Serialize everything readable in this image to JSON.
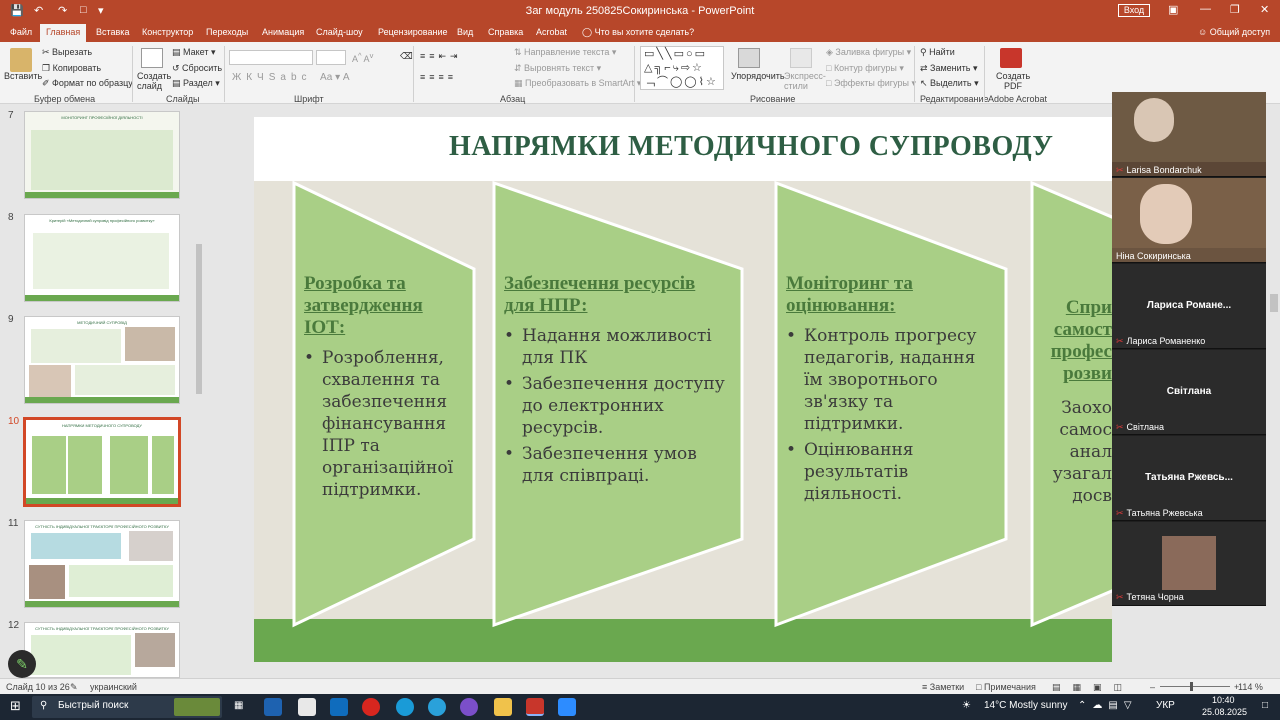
{
  "window": {
    "title": "Заг модуль 250825Сокиринська  -  PowerPoint",
    "signin": "Вход"
  },
  "menu": {
    "tabs": [
      "Файл",
      "Главная",
      "Вставка",
      "Конструктор",
      "Переходы",
      "Анимация",
      "Слайд-шоу",
      "Рецензирование",
      "Вид",
      "Справка",
      "Acrobat"
    ],
    "search": "Что вы хотите сделать?",
    "share": "Общий доступ"
  },
  "ribbon": {
    "paste": "Вставить",
    "cut": "Вырезать",
    "copy": "Копировать",
    "format_painter": "Формат по образцу",
    "clipboard_group": "Буфер обмена",
    "new_slide": "Создать слайд",
    "layout": "Макет",
    "reset": "Сбросить",
    "section": "Раздел",
    "slides_group": "Слайды",
    "font_group": "Шрифт",
    "text_direction": "Направление текста",
    "align_text": "Выровнять текст",
    "convert_smartart": "Преобразовать в SmartArt",
    "paragraph_group": "Абзац",
    "arrange": "Упорядочить",
    "quick_styles": "Экспресс-стили",
    "shape_fill": "Заливка фигуры",
    "shape_outline": "Контур фигуры",
    "shape_effects": "Эффекты фигуры",
    "drawing_group": "Рисование",
    "find": "Найти",
    "replace": "Заменить",
    "select": "Выделить",
    "editing_group": "Редактирование",
    "create_pdf": "Создать PDF",
    "acrobat_group": "Adobe Acrobat"
  },
  "thumbnails": [
    {
      "num": "7",
      "title": "МОНІТОРИНГ ПРОФЕСІЙНОЇ ДІЯЛЬНОСТІ"
    },
    {
      "num": "8",
      "title": "Критерій «Методичний супровід професійного розвитку»"
    },
    {
      "num": "9",
      "title": "МЕТОДИЧНИЙ СУПРОВІД"
    },
    {
      "num": "10",
      "title": "НАПРЯМКИ МЕТОДИЧНОГО СУПРОВОДУ"
    },
    {
      "num": "11",
      "title": "СУТНІСТЬ ІНДИВІДУАЛЬНОЇ ТРАЄКТОРІЇ ПРОФЕСІЙНОГО РОЗВИТКУ"
    },
    {
      "num": "12",
      "title": "СУТНІСТЬ ІНДИВІДУАЛЬНОЇ ТРАЄКТОРІЇ ПРОФЕСІЙНОГО РОЗВИТКУ"
    }
  ],
  "slide": {
    "title": "НАПРЯМКИ МЕТОДИЧНОГО СУПРОВОДУ",
    "col1": {
      "head": "Розробка та затвердження ІОТ:",
      "items": [
        "Розроблення, схвалення   та забезпечення фінансування ІПР та організаційної підтримки."
      ]
    },
    "col2": {
      "head": "Забезпечення ресурсів для НПР:",
      "items": [
        "Надання можливості для ПК",
        "Забезпечення доступу до електронних ресурсів.",
        "Забезпечення умов для співпраці."
      ]
    },
    "col3": {
      "head": "Моніторинг та оцінювання:",
      "items": [
        "Контроль прогресу педагогів, надання їм зворотнього зв'язку та підтримки.",
        "Оцінювання результатів діяльності."
      ]
    },
    "col4": {
      "head": "Спри самост профес розви",
      "body": "Заохо самос анал узагал досв"
    }
  },
  "video": {
    "participants": [
      {
        "label": "Larisa Bondarchuk"
      },
      {
        "label": "Ніна Сокиринська"
      },
      {
        "name": "Лариса  Романе...",
        "label": "Лариса Романенко"
      },
      {
        "name": "Світлана",
        "label": "Світлана"
      },
      {
        "name": "Татьяна  Ржевсь...",
        "label": "Татьяна Ржевська"
      },
      {
        "label": "Тетяна Чорна"
      }
    ]
  },
  "status": {
    "slide": "Слайд 10 из 26",
    "lang": "украинский",
    "notes": "Заметки",
    "comments": "Примечания",
    "zoom": "114 %"
  },
  "taskbar": {
    "search": "Быстрый поиск",
    "weather": "14°C  Mostly sunny",
    "lang": "УКР",
    "time": "10:40",
    "date": "25.08.2025"
  },
  "colors": {
    "accent": "#b7472a",
    "slide_green": "#a9cf86",
    "title_green": "#2e5e44"
  }
}
